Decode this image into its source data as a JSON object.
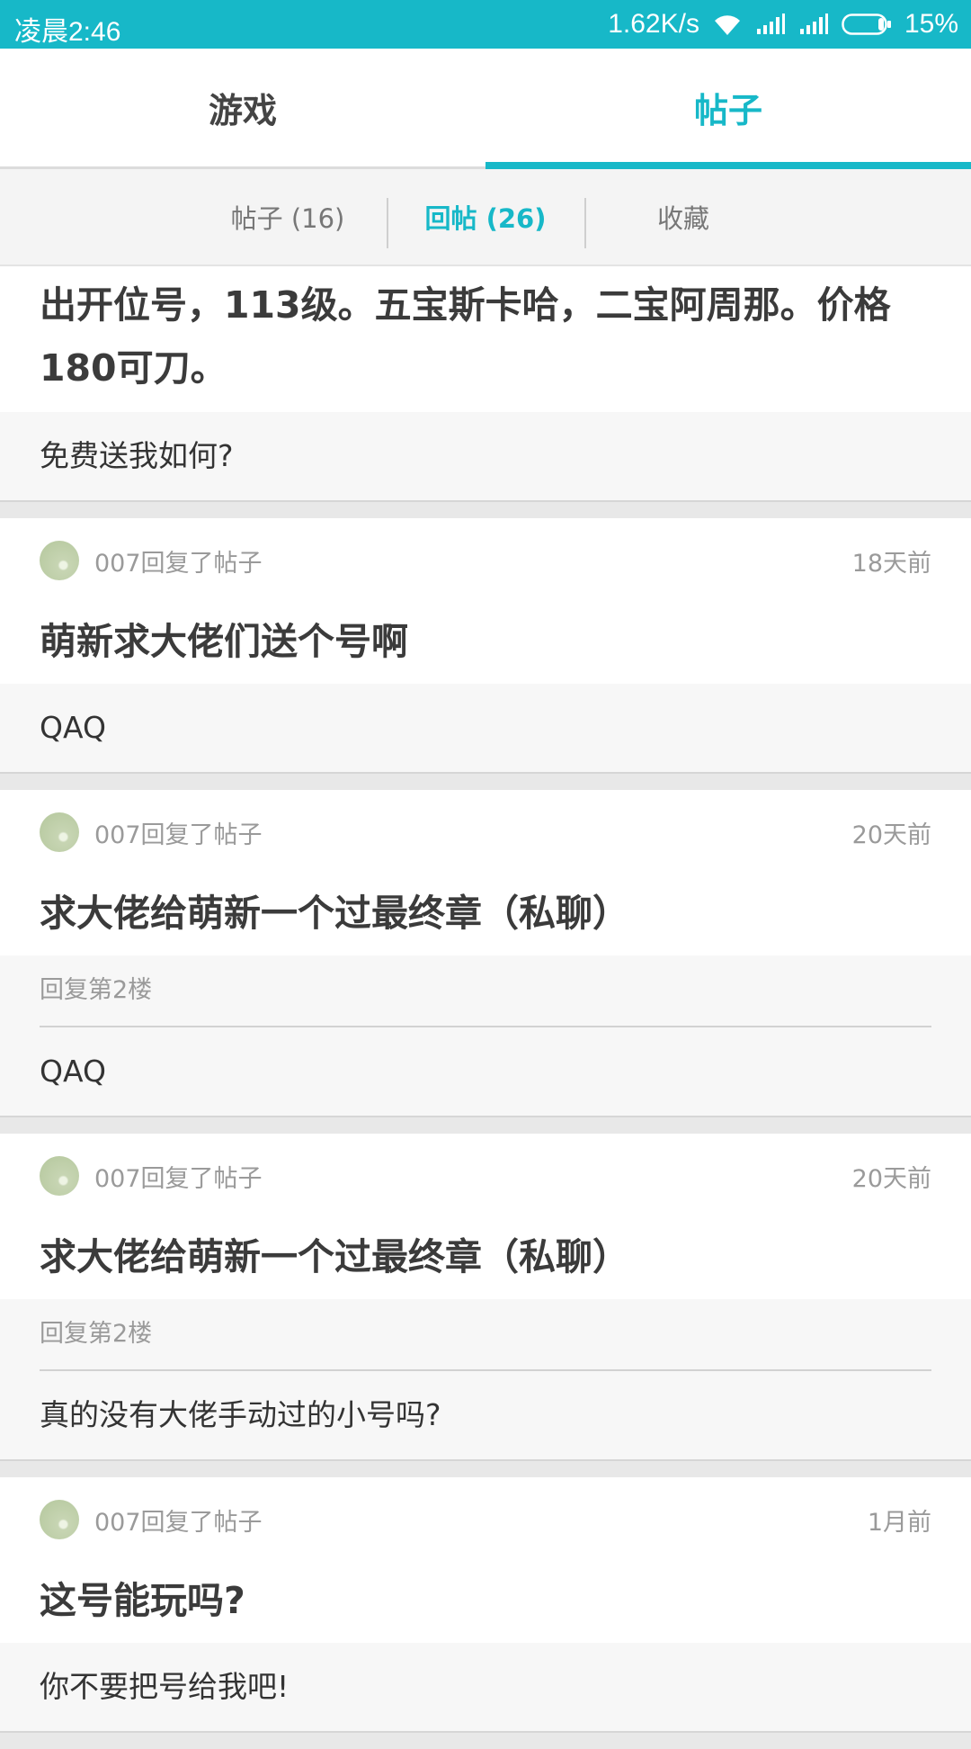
{
  "status_bar": {
    "time": "凌晨2:46",
    "speed": "1.62K/s",
    "battery": "15%"
  },
  "top_tabs": [
    {
      "label": "游戏",
      "active": false
    },
    {
      "label": "帖子",
      "active": true
    }
  ],
  "sub_tabs": [
    {
      "label": "帖子 (16)",
      "active": false
    },
    {
      "label": "回帖 (26)",
      "active": true
    },
    {
      "label": "收藏",
      "active": false
    }
  ],
  "colors": {
    "accent": "#17b8c8"
  },
  "posts": [
    {
      "title": "出开位号，113级。五宝斯卡哈，二宝阿周那。价格180可刀。",
      "reply": "免费送我如何?"
    },
    {
      "author": "007回复了帖子",
      "time": "18天前",
      "title": "萌新求大佬们送个号啊",
      "reply": "QAQ"
    },
    {
      "author": "007回复了帖子",
      "time": "20天前",
      "title": "求大佬给萌新一个过最终章（私聊）",
      "floor": "回复第2楼",
      "reply": "QAQ"
    },
    {
      "author": "007回复了帖子",
      "time": "20天前",
      "title": "求大佬给萌新一个过最终章（私聊）",
      "floor": "回复第2楼",
      "reply": "真的没有大佬手动过的小号吗?"
    },
    {
      "author": "007回复了帖子",
      "time": "1月前",
      "title": "这号能玩吗?",
      "reply": "你不要把号给我吧!"
    }
  ]
}
